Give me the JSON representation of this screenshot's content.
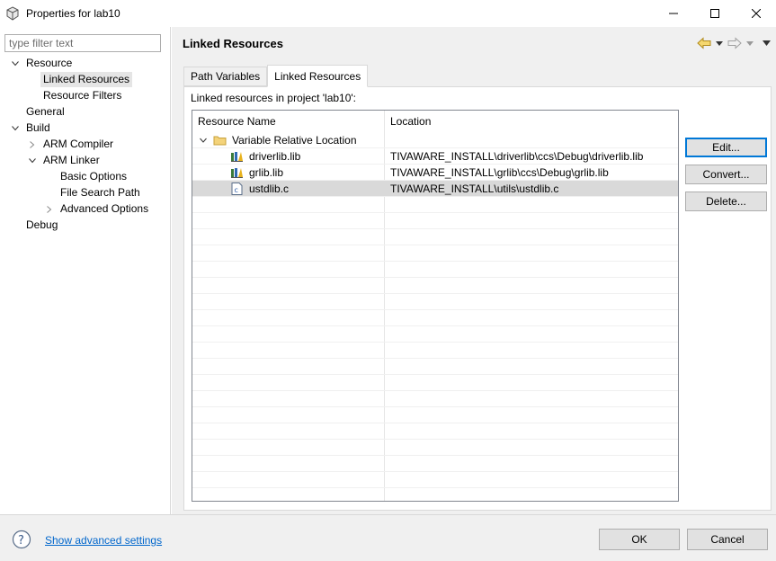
{
  "window": {
    "title": "Properties for lab10",
    "icon": "properties-app-icon"
  },
  "sidebar": {
    "filter_placeholder": "type filter text",
    "items": [
      {
        "label": "Resource"
      },
      {
        "label": "Linked Resources"
      },
      {
        "label": "Resource Filters"
      },
      {
        "label": "General"
      },
      {
        "label": "Build"
      },
      {
        "label": "ARM Compiler"
      },
      {
        "label": "ARM Linker"
      },
      {
        "label": "Basic Options"
      },
      {
        "label": "File Search Path"
      },
      {
        "label": "Advanced Options"
      },
      {
        "label": "Debug"
      }
    ],
    "selected": "Linked Resources"
  },
  "page": {
    "title": "Linked Resources",
    "tabs": [
      {
        "label": "Path Variables"
      },
      {
        "label": "Linked Resources"
      }
    ],
    "active_tab": "Linked Resources",
    "caption": "Linked resources in project 'lab10':",
    "table": {
      "headers": [
        "Resource Name",
        "Location"
      ],
      "group": "Variable Relative Location",
      "rows": [
        {
          "name": "driverlib.lib",
          "location": "TIVAWARE_INSTALL\\driverlib\\ccs\\Debug\\driverlib.lib",
          "icon": "library-file-icon"
        },
        {
          "name": "grlib.lib",
          "location": "TIVAWARE_INSTALL\\grlib\\ccs\\Debug\\grlib.lib",
          "icon": "library-file-icon"
        },
        {
          "name": "ustdlib.c",
          "location": "TIVAWARE_INSTALL\\utils\\ustdlib.c",
          "icon": "c-source-file-icon"
        }
      ],
      "selected_row": "ustdlib.c"
    },
    "buttons": {
      "edit": "Edit...",
      "convert": "Convert...",
      "delete": "Delete..."
    }
  },
  "footer": {
    "advanced_link": "Show advanced settings",
    "ok": "OK",
    "cancel": "Cancel"
  },
  "colors": {
    "accent": "#0078d7",
    "link": "#0066cc",
    "selection": "#d9d9d9",
    "panel": "#f0f0f0"
  }
}
